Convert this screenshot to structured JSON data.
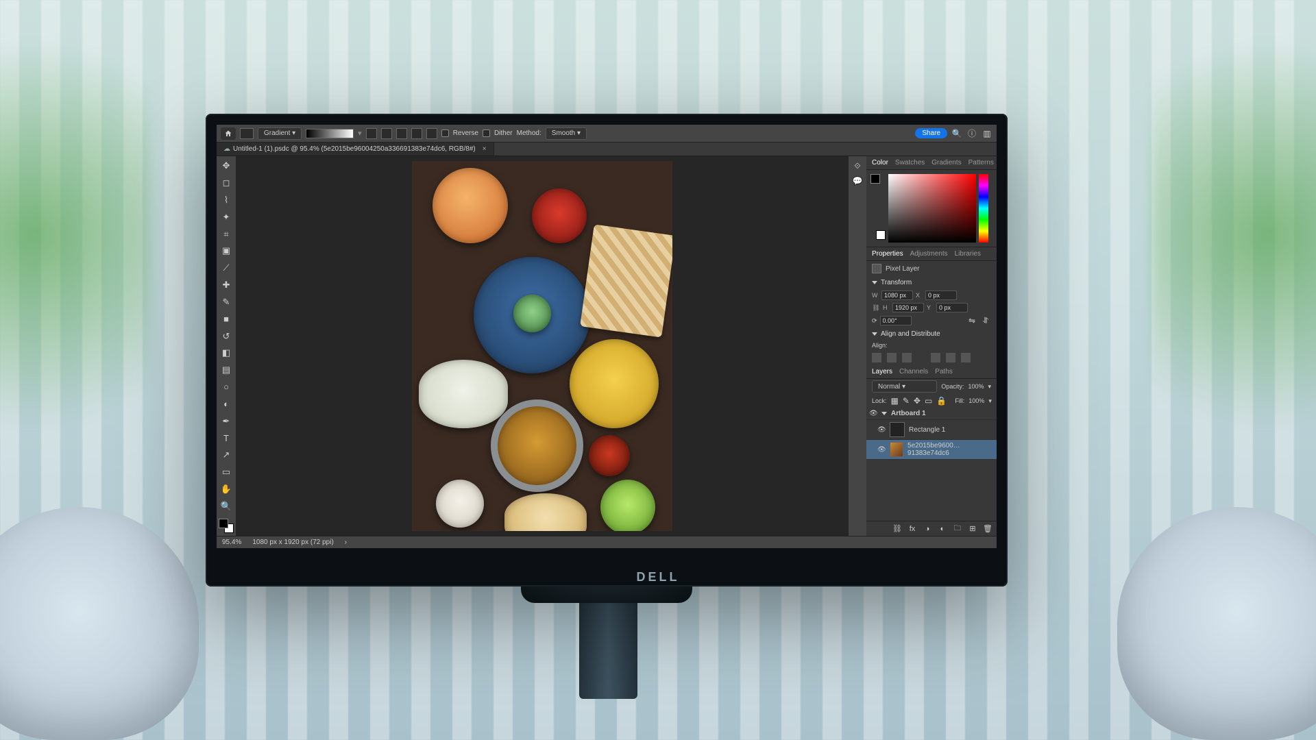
{
  "monitor_brand": "DELL",
  "options_bar": {
    "tool_name": "Gradient",
    "reverse_label": "Reverse",
    "dither_label": "Dither",
    "method_label": "Method:",
    "method_value": "Smooth",
    "share_label": "Share"
  },
  "document_tab": {
    "filename": "Untitled-1 (1).psdc @ 95.4% (5e2015be96004250a336691383e74dc6, RGB/8#)"
  },
  "toolbar_items": [
    {
      "name": "move-tool",
      "glyph": "✥"
    },
    {
      "name": "marquee-tool",
      "glyph": "◻"
    },
    {
      "name": "lasso-tool",
      "glyph": "⌇"
    },
    {
      "name": "wand-tool",
      "glyph": "✦"
    },
    {
      "name": "crop-tool",
      "glyph": "⌗"
    },
    {
      "name": "frame-tool",
      "glyph": "▣"
    },
    {
      "name": "eyedropper-tool",
      "glyph": "⟋"
    },
    {
      "name": "healing-tool",
      "glyph": "✚"
    },
    {
      "name": "brush-tool",
      "glyph": "✎"
    },
    {
      "name": "stamp-tool",
      "glyph": "■"
    },
    {
      "name": "history-brush-tool",
      "glyph": "↺"
    },
    {
      "name": "eraser-tool",
      "glyph": "◧"
    },
    {
      "name": "gradient-tool",
      "glyph": "▤"
    },
    {
      "name": "blur-tool",
      "glyph": "○"
    },
    {
      "name": "dodge-tool",
      "glyph": "◐"
    },
    {
      "name": "pen-tool",
      "glyph": "✒"
    },
    {
      "name": "type-tool",
      "glyph": "T"
    },
    {
      "name": "path-tool",
      "glyph": "↗"
    },
    {
      "name": "shape-tool",
      "glyph": "▭"
    },
    {
      "name": "hand-tool",
      "glyph": "✋"
    },
    {
      "name": "zoom-tool",
      "glyph": "🔍"
    }
  ],
  "color_tabs": [
    "Color",
    "Swatches",
    "Gradients",
    "Patterns"
  ],
  "active_color_tab": "Color",
  "props_tabs": [
    "Properties",
    "Adjustments",
    "Libraries"
  ],
  "active_props_tab": "Properties",
  "properties": {
    "layer_kind": "Pixel Layer",
    "transform_h": "Transform",
    "W": "1080 px",
    "H": "1920 px",
    "X": "0 px",
    "Y": "0 px",
    "angle": "0.00°",
    "align_h": "Align and Distribute",
    "align_label": "Align:"
  },
  "layers_tabs": [
    "Layers",
    "Channels",
    "Paths"
  ],
  "active_layers_tab": "Layers",
  "layers_panel": {
    "blend_mode": "Normal",
    "opacity_label": "Opacity:",
    "opacity_value": "100%",
    "lock_label": "Lock:",
    "fill_label": "Fill:",
    "fill_value": "100%"
  },
  "layers": [
    {
      "name": "Artboard 1",
      "type": "artboard",
      "visible": true,
      "selected": false
    },
    {
      "name": "Rectangle 1",
      "type": "shape",
      "visible": true,
      "selected": false
    },
    {
      "name": "5e2015be9600…91383e74dc6",
      "type": "pixel",
      "visible": true,
      "selected": true
    }
  ],
  "status_bar": {
    "zoom": "95.4%",
    "doc_dims": "1080 px x 1920 px (72 ppi)"
  }
}
